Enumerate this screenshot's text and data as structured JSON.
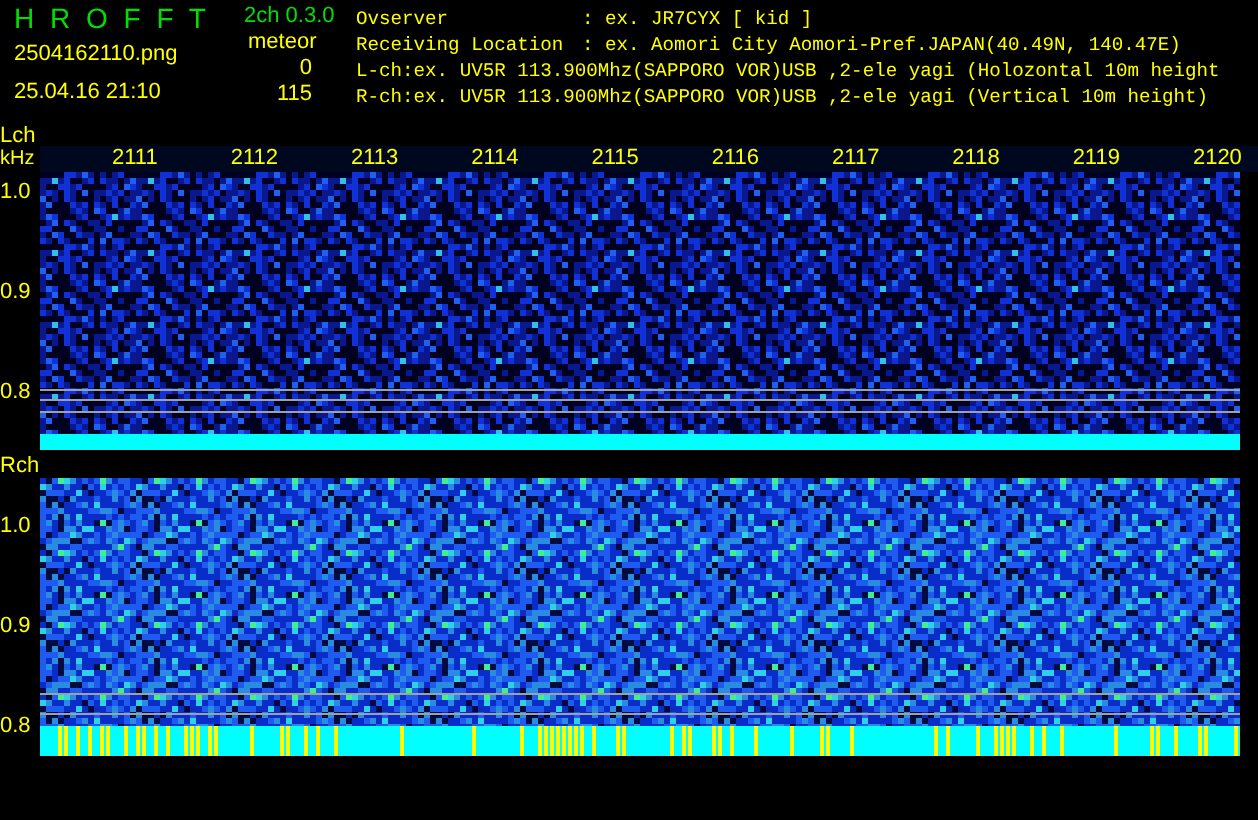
{
  "header": {
    "app_name": "H R O F F T",
    "version": "2ch 0.3.0",
    "filename": "2504162110.png",
    "timestamp": "25.04.16 21:10",
    "meteor_label": "meteor",
    "meteor_counts": [
      "0",
      "115"
    ],
    "info_lines": [
      {
        "kind": "field",
        "label": "Ovserver",
        "value": ": ex. JR7CYX [ kid ]"
      },
      {
        "kind": "field",
        "label": "Receiving Location",
        "value": ": ex. Aomori City Aomori-Pref.JAPAN(40.49N, 140.47E)"
      },
      {
        "kind": "text",
        "text": "L-ch:ex. UV5R 113.900Mhz(SAPPORO VOR)USB ,2-ele yagi (Holozontal 10m height"
      },
      {
        "kind": "text",
        "text": "R-ch:ex. UV5R 113.900Mhz(SAPPORO VOR)USB ,2-ele yagi (Vertical 10m height)"
      }
    ]
  },
  "channels": [
    {
      "label": "Lch",
      "unit": "kHz",
      "yticks": [
        "1.0",
        "0.9",
        "0.8"
      ],
      "time_labels": [
        "2111",
        "2112",
        "2113",
        "2114",
        "2115",
        "2116",
        "2117",
        "2118",
        "2119",
        "2120"
      ],
      "kind": "quiet"
    },
    {
      "label": "Rch",
      "yticks": [
        "1.0",
        "0.9",
        "0.8"
      ],
      "kind": "busy"
    }
  ]
}
